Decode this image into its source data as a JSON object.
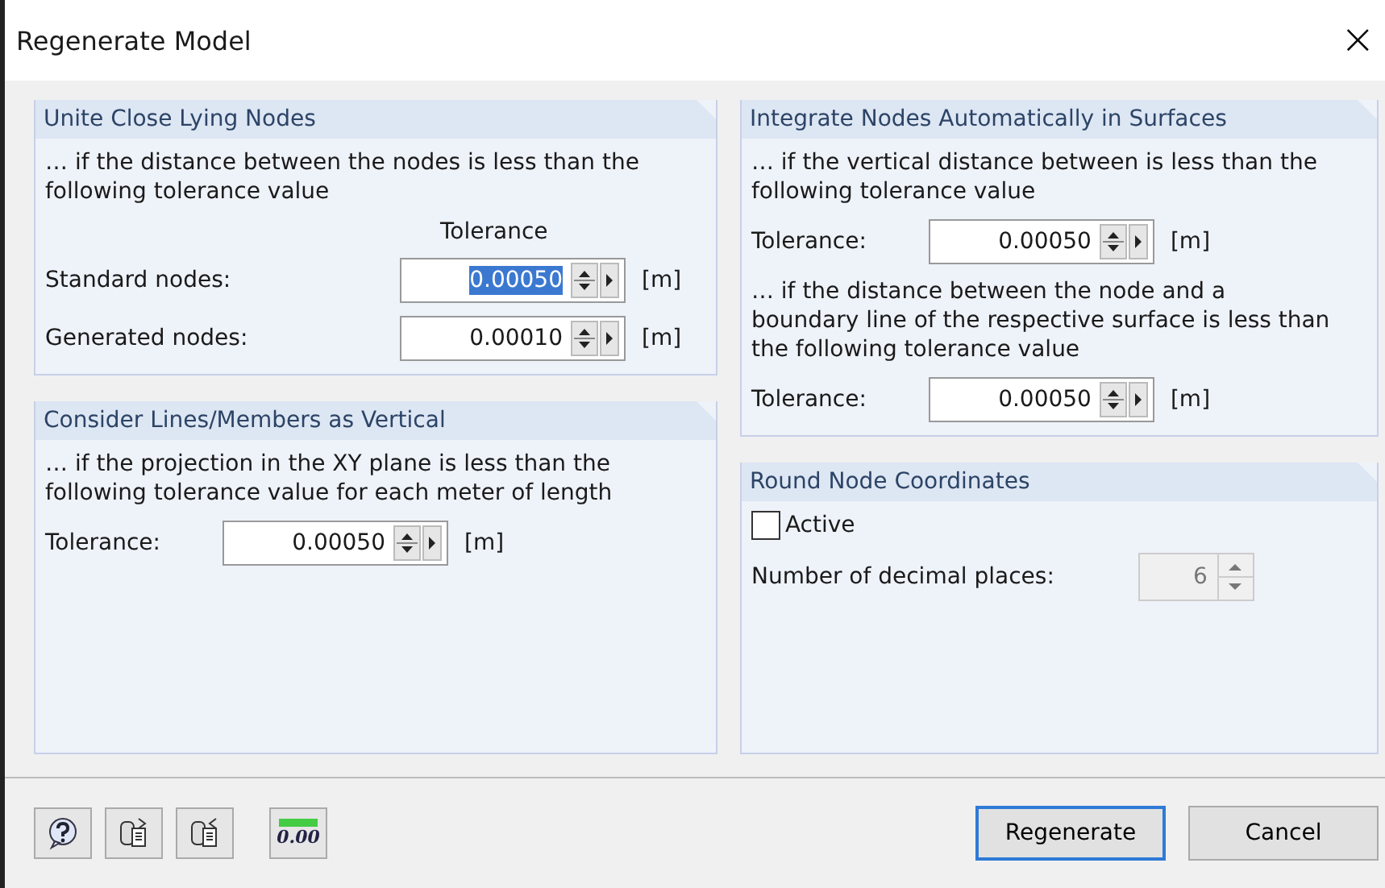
{
  "window": {
    "title": "Regenerate Model",
    "close": "×"
  },
  "columns": [
    [
      {
        "title": "Unite Close Lying Nodes",
        "items": [
          {
            "kind": "text",
            "text": "… if the distance between the nodes is less than the following tolerance value"
          },
          {
            "kind": "header",
            "text": "Tolerance"
          },
          {
            "kind": "field",
            "label": "Standard nodes:",
            "value": "0.00050",
            "unit": "[m]",
            "selected": true
          },
          {
            "kind": "field",
            "label": "Generated nodes:",
            "value": "0.00010",
            "unit": "[m]",
            "selected": false
          }
        ]
      },
      {
        "title": "Consider Lines/Members as Vertical",
        "items": [
          {
            "kind": "text",
            "text": "… if the projection in the XY plane is less than the following tolerance value for each meter of length"
          },
          {
            "kind": "field",
            "label": "Tolerance:",
            "value": "0.00050",
            "unit": "[m]",
            "selected": false
          }
        ]
      }
    ],
    [
      {
        "title": "Integrate Nodes Automatically in Surfaces",
        "items": [
          {
            "kind": "text",
            "text": "… if the vertical distance between is less than the following tolerance value"
          },
          {
            "kind": "field",
            "label": "Tolerance:",
            "value": "0.00050",
            "unit": "[m]",
            "selected": false
          },
          {
            "kind": "text",
            "text": "… if the distance between the node and a boundary line of the respective surface is less than the following tolerance value"
          },
          {
            "kind": "field",
            "label": "Tolerance:",
            "value": "0.00050",
            "unit": "[m]",
            "selected": false
          }
        ]
      },
      {
        "title": "Round Node Coordinates",
        "items": [
          {
            "kind": "checkbox",
            "label": "Active",
            "checked": false
          },
          {
            "kind": "spin",
            "label": "Number of decimal places:",
            "value": "6",
            "disabled": true
          }
        ]
      }
    ]
  ],
  "tool_buttons": [
    {
      "kind": "help"
    },
    {
      "kind": "export"
    },
    {
      "kind": "import"
    },
    {
      "kind": "units",
      "text": "0.00"
    }
  ],
  "buttons": [
    {
      "label": "Regenerate",
      "selected": true
    },
    {
      "label": "Cancel",
      "selected": false
    }
  ]
}
